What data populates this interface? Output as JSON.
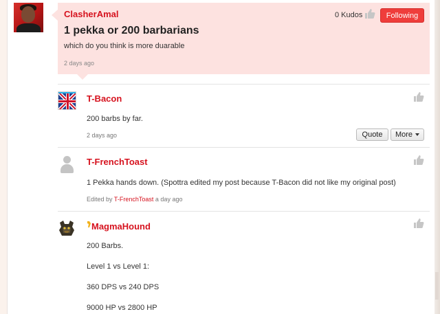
{
  "thread": {
    "author": "ClasherAmal",
    "title": "1 pekka or 200 barbarians",
    "body": "which do you think is more duarable",
    "time": "2 days ago",
    "kudos": "0 Kudos",
    "follow_label": "Following"
  },
  "replies": [
    {
      "author": "T-Bacon",
      "text": "200 barbs by far.",
      "time": "2 days ago",
      "quote_label": "Quote",
      "more_label": "More"
    },
    {
      "author": "T-FrenchToast",
      "text": "1 Pekka hands down. (Spottra edited my post because T-Bacon did not like my original post)",
      "edited_prefix": "Edited by",
      "edited_by": "T-FrenchToast",
      "edited_time": "a day ago"
    },
    {
      "author": "MagmaHound",
      "lines": [
        "200 Barbs.",
        "Level 1 vs Level 1:",
        "360 DPS vs 240 DPS",
        "9000 HP vs 2800 HP"
      ]
    }
  ],
  "colors": {
    "accent": "#d6121e",
    "op_background": "#fde2e0",
    "follow_button": "#ef3d3b"
  },
  "icons": [
    "thumbs-up-icon",
    "caret-down-icon",
    "rank-icon"
  ]
}
